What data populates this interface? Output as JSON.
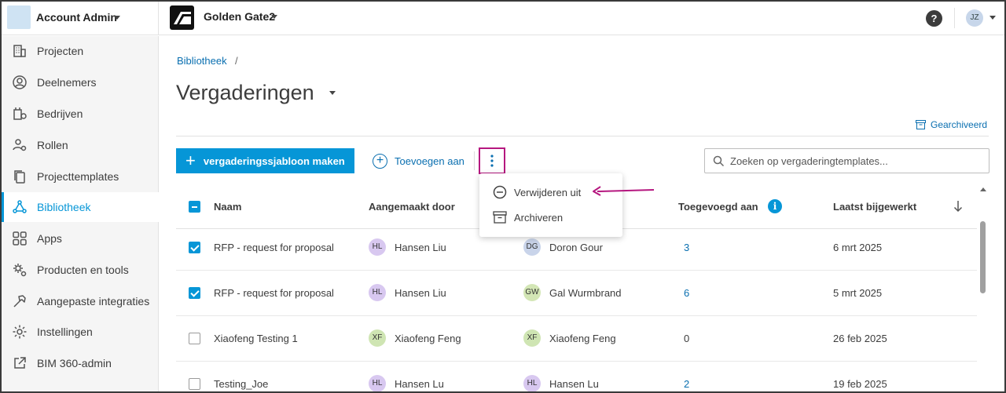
{
  "topbar": {
    "account_name": "Account Admin",
    "project_name": "Golden Gate2",
    "help_label": "?",
    "user_initials": "JZ"
  },
  "sidebar": {
    "items": [
      {
        "label": "Projecten",
        "icon": "building-icon"
      },
      {
        "label": "Deelnemers",
        "icon": "person-circle-icon"
      },
      {
        "label": "Bedrijven",
        "icon": "company-icon"
      },
      {
        "label": "Rollen",
        "icon": "person-gear-icon"
      },
      {
        "label": "Projecttemplates",
        "icon": "copy-icon"
      },
      {
        "label": "Bibliotheek",
        "icon": "network-icon",
        "active": true
      },
      {
        "label": "Apps",
        "icon": "apps-grid-icon"
      },
      {
        "label": "Producten en tools",
        "icon": "tools-gear-icon"
      },
      {
        "label": "Aangepaste integraties",
        "icon": "hammer-icon"
      },
      {
        "label": "Instellingen",
        "icon": "gear-icon"
      },
      {
        "label": "BIM 360-admin",
        "icon": "external-link-icon"
      }
    ]
  },
  "main": {
    "breadcrumb": "Bibliotheek",
    "breadcrumb_sep": "/",
    "title": "Vergaderingen",
    "archived_link": "Gearchiveerd",
    "create_button": "vergaderingssjabloon maken",
    "add_to_button": "Toevoegen aan",
    "search_placeholder": "Zoeken op vergaderingtemplates..."
  },
  "table": {
    "headers": {
      "name": "Naam",
      "created_by": "Aangemaakt door",
      "added_to": "Toegevoegd aan",
      "updated": "Laatst bijgewerkt"
    },
    "rows": [
      {
        "checked": true,
        "name": "RFP - request for proposal",
        "creator_initials": "HL",
        "creator": "Hansen Liu",
        "creator_color": "hl",
        "updater_initials": "DG",
        "updater": "Doron Gour",
        "updater_color": "dg",
        "added_to": "3",
        "added_link": true,
        "updated": "6 mrt 2025"
      },
      {
        "checked": true,
        "name": "RFP - request for proposal",
        "creator_initials": "HL",
        "creator": "Hansen Liu",
        "creator_color": "hl",
        "updater_initials": "GW",
        "updater": "Gal Wurmbrand",
        "updater_color": "gw",
        "added_to": "6",
        "added_link": true,
        "updated": "5 mrt 2025"
      },
      {
        "checked": false,
        "name": "Xiaofeng Testing 1",
        "creator_initials": "XF",
        "creator": "Xiaofeng Feng",
        "creator_color": "xf",
        "updater_initials": "XF",
        "updater": "Xiaofeng Feng",
        "updater_color": "xf",
        "added_to": "0",
        "added_link": false,
        "updated": "26 feb 2025"
      },
      {
        "checked": false,
        "name": "Testing_Joe",
        "creator_initials": "HL",
        "creator": "Hansen Lu",
        "creator_color": "hl",
        "updater_initials": "HL",
        "updater": "Hansen Lu",
        "updater_color": "hl",
        "added_to": "2",
        "added_link": true,
        "updated": "19 feb 2025"
      }
    ]
  },
  "menu": {
    "items": [
      {
        "label": "Verwijderen uit",
        "icon": "minus-circle-icon"
      },
      {
        "label": "Archiveren",
        "icon": "archive-icon"
      }
    ]
  },
  "colors": {
    "accent": "#0696d7",
    "link": "#0a6fb0",
    "highlight": "#b5177f"
  }
}
